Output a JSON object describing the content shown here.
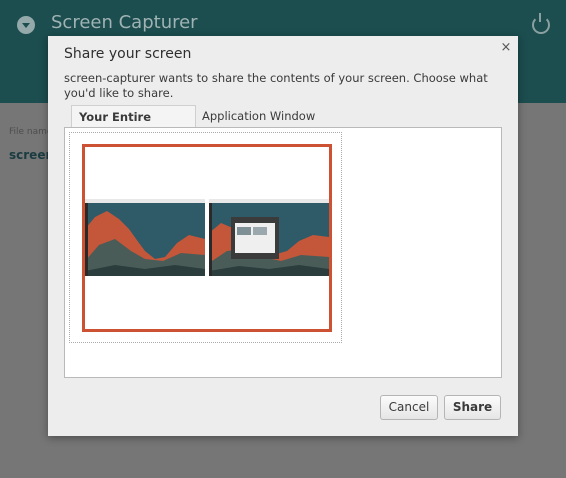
{
  "app": {
    "title": "Screen Capturer",
    "field_label": "File name",
    "field_value": "screen"
  },
  "dialog": {
    "title": "Share your screen",
    "message": "screen-capturer wants to share the contents of your screen. Choose what you'd like to share.",
    "tabs": [
      {
        "label": "Your Entire Screen",
        "active": true
      },
      {
        "label": "Application Window",
        "active": false
      }
    ],
    "selected_screen_border": "#cd5234",
    "cancel_label": "Cancel",
    "share_label": "Share",
    "close_glyph": "×"
  },
  "icons": {
    "menu": "chevron-down-circle-icon",
    "power": "power-icon",
    "close": "close-icon"
  }
}
